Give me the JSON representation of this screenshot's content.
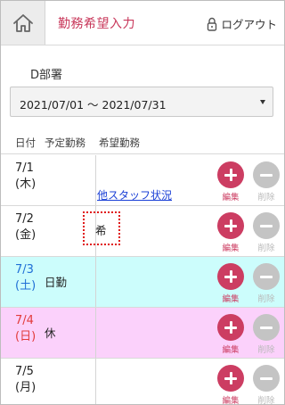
{
  "header": {
    "title": "勤務希望入力",
    "logout_label": "ログアウト"
  },
  "department": "D部署",
  "period": {
    "selected": "2021/07/01 ～ 2021/07/31"
  },
  "table": {
    "columns": [
      "日付",
      "予定勤務",
      "希望勤務"
    ],
    "staff_link": "他スタッフ状況",
    "edit_label": "編集",
    "delete_label": "削除",
    "rows": [
      {
        "date": "7/1",
        "weekday": "(木)",
        "schedule": "",
        "request": ""
      },
      {
        "date": "7/2",
        "weekday": "(金)",
        "schedule": "",
        "request": "希"
      },
      {
        "date": "7/3",
        "weekday": "(土)",
        "schedule": "日勤",
        "request": ""
      },
      {
        "date": "7/4",
        "weekday": "(日)",
        "schedule": "休",
        "request": ""
      },
      {
        "date": "7/5",
        "weekday": "(月)",
        "schedule": "",
        "request": ""
      }
    ]
  },
  "colors": {
    "accent": "#cc3d62",
    "saturday_bg": "#ccfdfc",
    "sunday_bg": "#fbd1fb",
    "saturday_text": "#1f6fd6",
    "sunday_text": "#e23b3b",
    "disabled": "#c4c4c4",
    "highlight_border": "#e01818"
  },
  "icons": {
    "home": "home-icon",
    "logout": "lock-icon",
    "edit": "plus-icon",
    "delete": "minus-icon",
    "dropdown": "caret-down-icon"
  }
}
